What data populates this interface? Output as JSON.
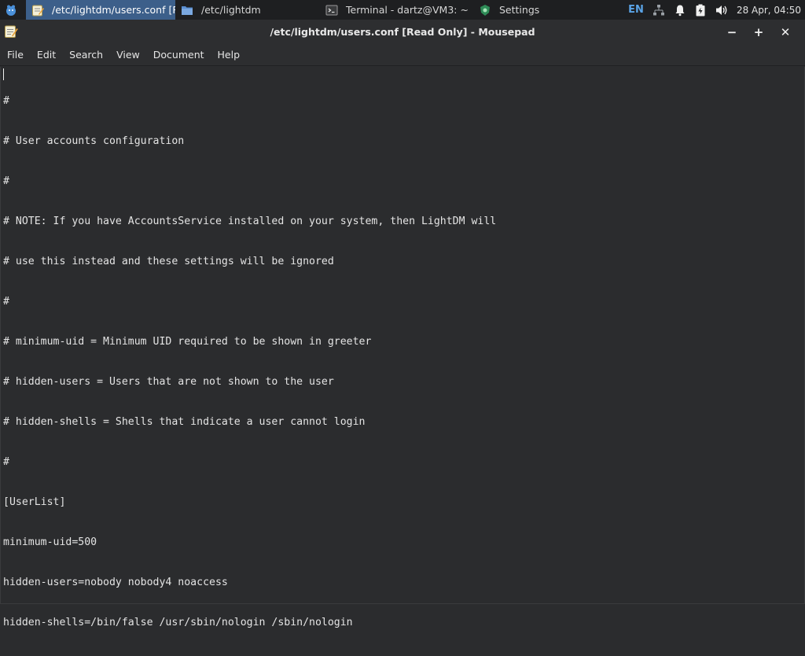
{
  "panel": {
    "tasks": [
      {
        "label": "/etc/lightdm/users.conf [Re...",
        "active": true
      },
      {
        "label": "/etc/lightdm",
        "active": false
      },
      {
        "label": "Terminal - dartz@VM3: ~",
        "active": false
      },
      {
        "label": "Settings",
        "active": false
      }
    ],
    "language": "EN",
    "clock": "28 Apr, 04:50"
  },
  "window": {
    "title": "/etc/lightdm/users.conf [Read Only] - Mousepad",
    "minimize": "−",
    "maximize": "+",
    "close": "✕"
  },
  "menubar": {
    "items": [
      "File",
      "Edit",
      "Search",
      "View",
      "Document",
      "Help"
    ]
  },
  "editor": {
    "lines": [
      "#",
      "# User accounts configuration",
      "#",
      "# NOTE: If you have AccountsService installed on your system, then LightDM will",
      "# use this instead and these settings will be ignored",
      "#",
      "# minimum-uid = Minimum UID required to be shown in greeter",
      "# hidden-users = Users that are not shown to the user",
      "# hidden-shells = Shells that indicate a user cannot login",
      "#",
      "[UserList]",
      "minimum-uid=500",
      "hidden-users=nobody nobody4 noaccess",
      "hidden-shells=/bin/false /usr/sbin/nologin /sbin/nologin"
    ]
  },
  "colors": {
    "active_task": "#3c5f8a",
    "language_indicator": "#5aa3e6",
    "editor_bg": "#2b2c2e"
  }
}
